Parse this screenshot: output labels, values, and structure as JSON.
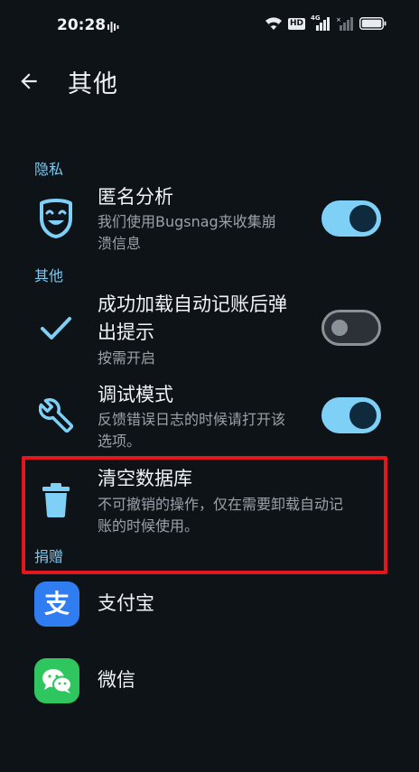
{
  "status_bar": {
    "time": "20:28",
    "hd_badge": "HD",
    "network_label": "4G"
  },
  "header": {
    "title": "其他"
  },
  "sections": {
    "privacy": "隐私",
    "other": "其他",
    "donate": "捐赠"
  },
  "items": {
    "anonymous_analytics": {
      "title": "匿名分析",
      "subtitle_line1": "我们使用Bugsnag来收集崩",
      "subtitle_line2": "溃信息",
      "toggle": "on"
    },
    "success_prompt": {
      "title_line1": "成功加载自动记账后弹",
      "title_line2": "出提示",
      "subtitle": "按需开启",
      "toggle": "off"
    },
    "debug_mode": {
      "title": "调试模式",
      "subtitle_line1": "反馈错误日志的时候请打开该",
      "subtitle_line2": "选项。",
      "toggle": "on"
    },
    "clear_database": {
      "title": "清空数据库",
      "subtitle_line1": "不可撤销的操作，仅在需要卸载自动记",
      "subtitle_line2": "账的时候使用。"
    },
    "alipay": {
      "title": "支付宝",
      "icon_glyph": "支"
    },
    "wechat": {
      "title": "微信"
    }
  },
  "colors": {
    "background": "#0e1318",
    "accent": "#7ed0f7",
    "section_header": "#7cc8ef",
    "highlight": "#e3171b",
    "alipay": "#2f7df0",
    "wechat": "#2fc55f"
  }
}
